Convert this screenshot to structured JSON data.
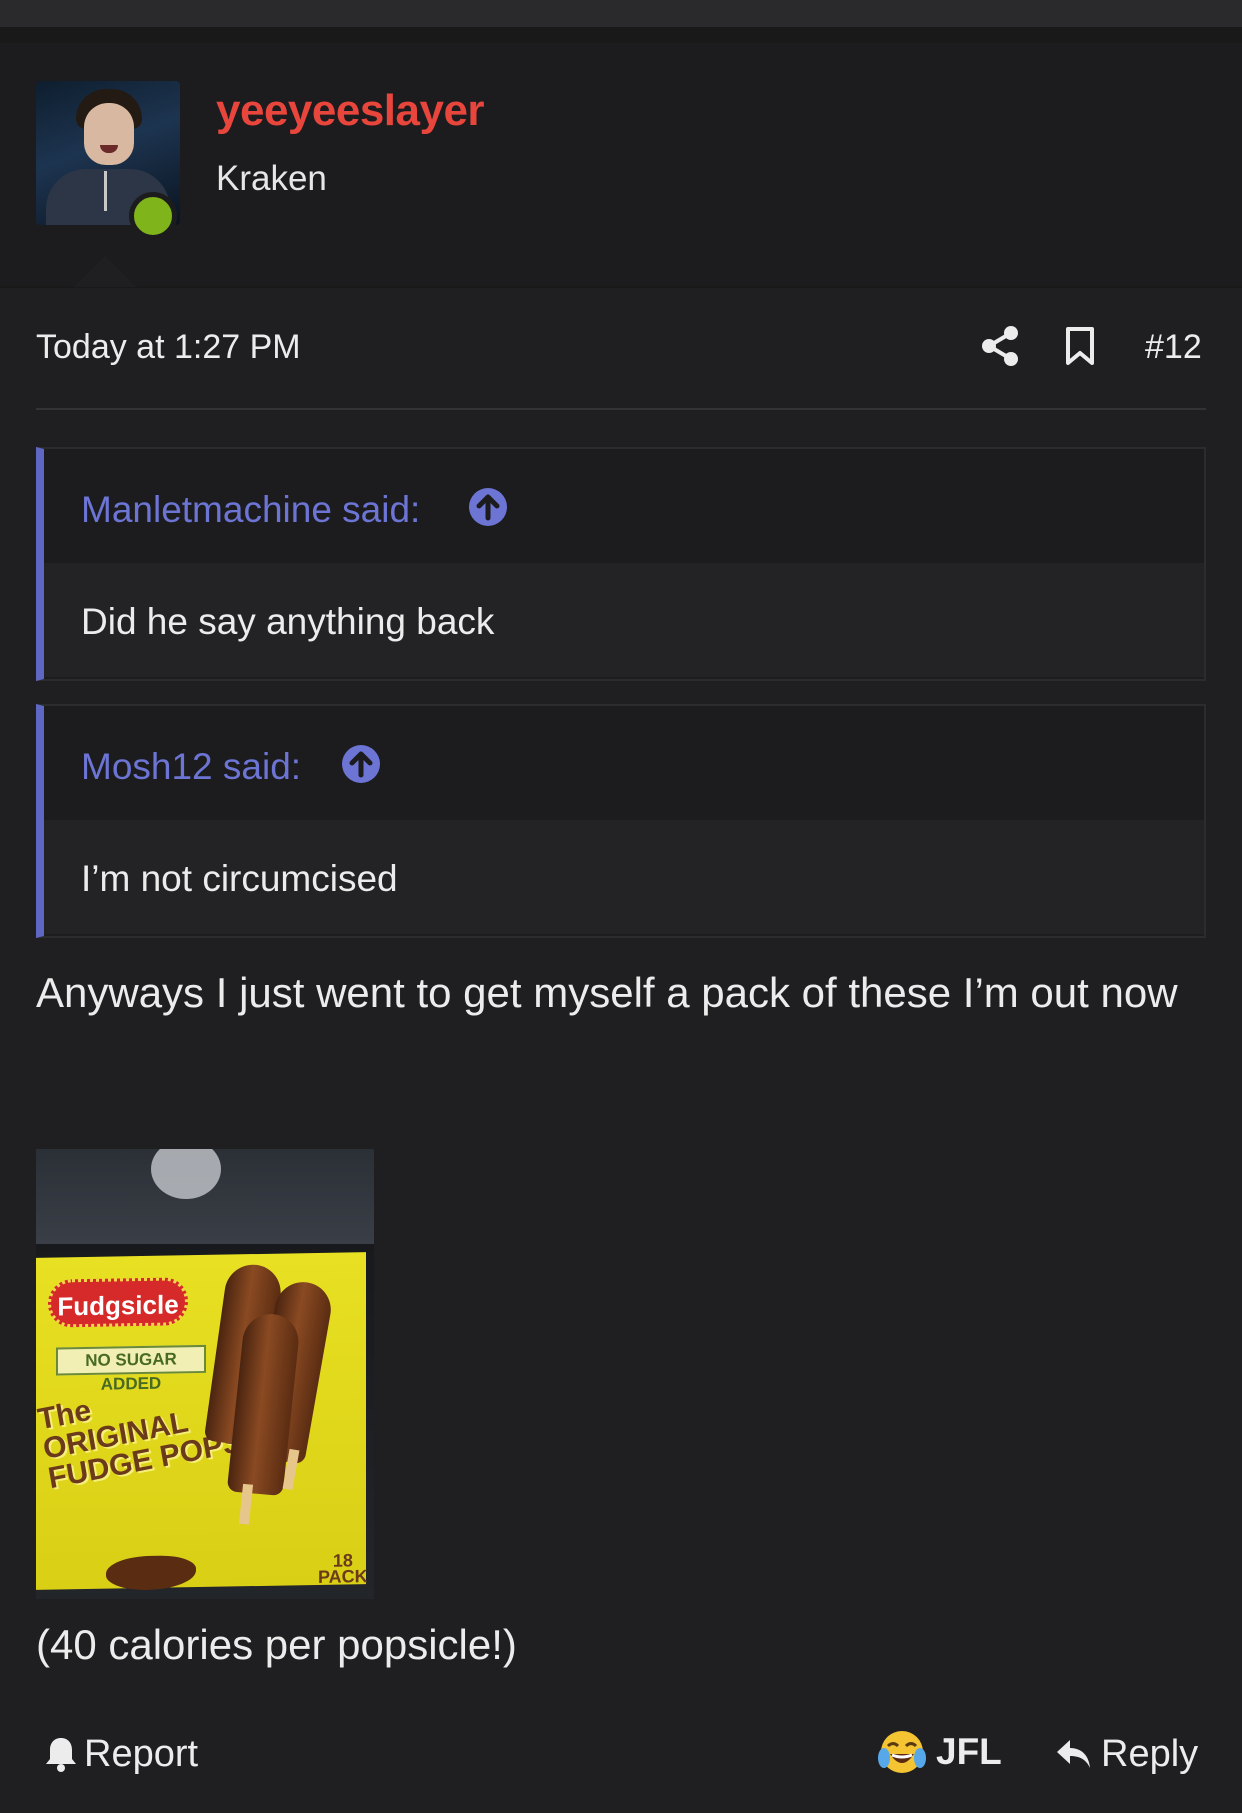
{
  "post": {
    "author": {
      "username": "yeeyeeslayer",
      "title": "Kraken",
      "online": true,
      "name_color": "#e8453c"
    },
    "timestamp": "Today at 1:27 PM",
    "post_number": "#12",
    "quotes": [
      {
        "author_said": "Manletmachine said:",
        "text": "Did he say anything back"
      },
      {
        "author_said": "Mosh12 said:",
        "text": "I’m not circumcised"
      }
    ],
    "message": "Anyways I just went to get myself a pack of these I’m out now",
    "image": {
      "alt_icon": "fudgsicle-photo",
      "box_text": {
        "brand": "Fudgsicle",
        "banner": "NO SUGAR ADDED",
        "product": "The ORIGINAL FUDGE POPS",
        "pack": "18 PACK"
      }
    },
    "caption": "(40 calories per popsicle!)"
  },
  "actions": {
    "report_label": "Report",
    "reaction_label": "JFL",
    "reaction_emoji": "😂",
    "reply_label": "Reply"
  },
  "colors": {
    "background": "#1f1f21",
    "quote_accent": "#5f67c4",
    "quote_author": "#6c74d4",
    "online": "#7fb41a"
  }
}
